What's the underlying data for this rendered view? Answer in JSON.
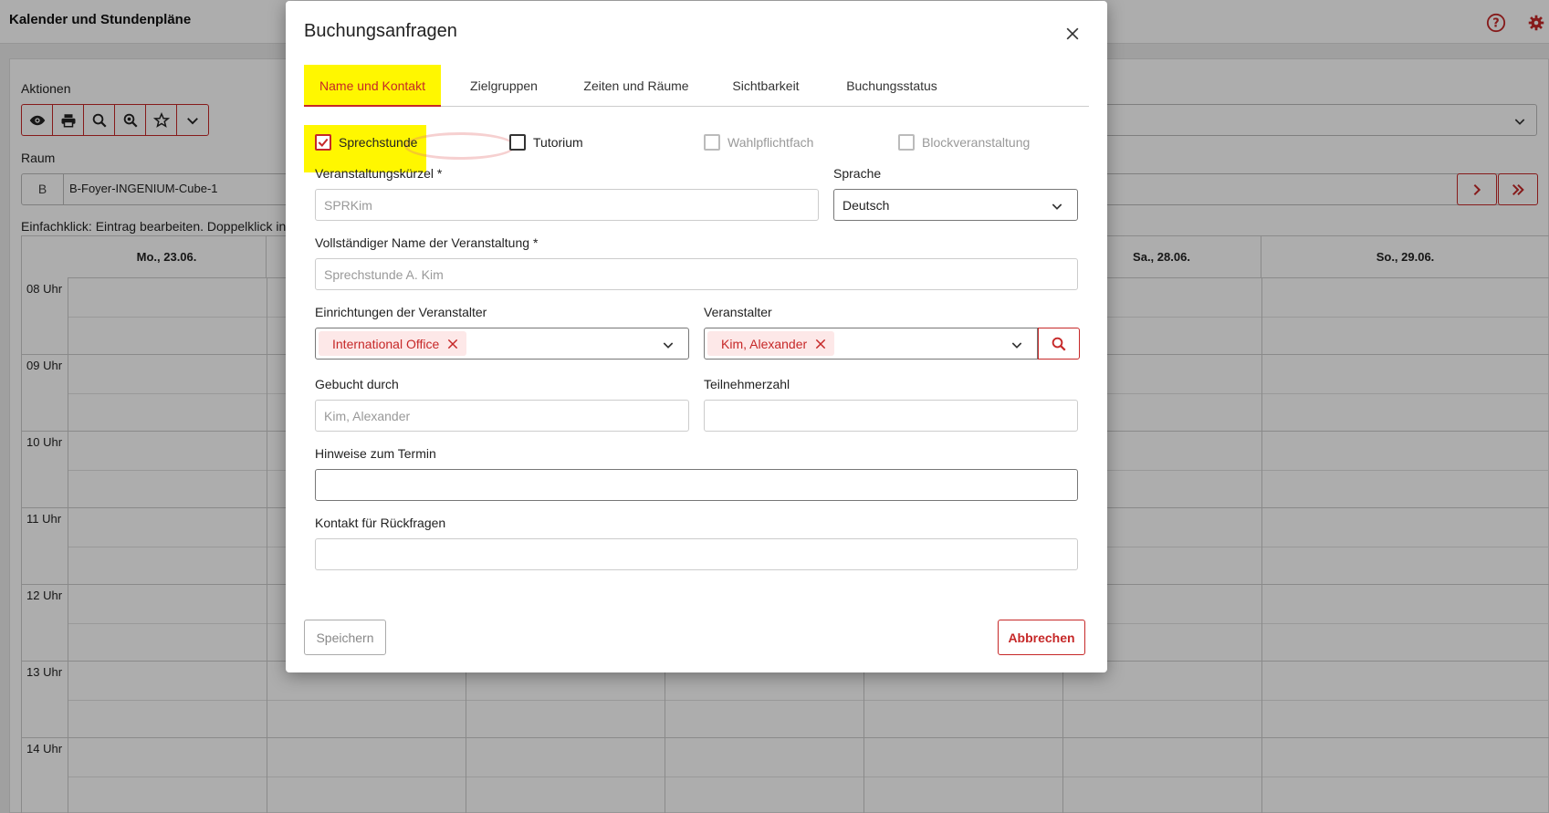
{
  "app": {
    "title": "Kalender und Stundenpläne",
    "accent_color": "#c62828",
    "highlight_color": "#fff700"
  },
  "background": {
    "actions_label": "Aktionen",
    "toolbar_icons": [
      "eye-icon",
      "print-icon",
      "search-icon",
      "zoom-icon",
      "star-icon",
      "chevron-down-icon"
    ],
    "room_label": "Raum",
    "room_prefix": "B",
    "room_name": "B-Foyer-INGENIUM-Cube-1",
    "hint": "Einfachklick: Eintrag bearbeiten. Doppelklick in",
    "days": [
      "Mo., 23.06.",
      "",
      "",
      "",
      "",
      "Sa., 28.06.",
      "So., 29.06."
    ],
    "hours": [
      "08 Uhr",
      "09 Uhr",
      "10 Uhr",
      "11 Uhr",
      "12 Uhr",
      "13 Uhr",
      "14 Uhr"
    ]
  },
  "modal": {
    "title": "Buchungsanfragen",
    "tabs": [
      "Name und Kontakt",
      "Zielgruppen",
      "Zeiten und Räume",
      "Sichtbarkeit",
      "Buchungsstatus"
    ],
    "active_tab": "Name und Kontakt",
    "checkboxes": [
      {
        "label": "Sprechstunde",
        "checked": true,
        "disabled": false
      },
      {
        "label": "Tutorium",
        "checked": false,
        "disabled": false
      },
      {
        "label": "Wahlpflichtfach",
        "checked": false,
        "disabled": true
      },
      {
        "label": "Blockveranstaltung",
        "checked": false,
        "disabled": true
      }
    ],
    "fields": {
      "kuerzel_label": "Veranstaltungskürzel",
      "kuerzel_placeholder": "SPRKim",
      "sprache_label": "Sprache",
      "sprache_value": "Deutsch",
      "name_label": "Vollständiger Name der Veranstaltung",
      "name_placeholder": "Sprechstunde  A. Kim",
      "einrichtungen_label": "Einrichtungen der Veranstalter",
      "einrichtungen_chip": "International Office",
      "veranstalter_label": "Veranstalter",
      "veranstalter_chip": "Kim, Alexander",
      "gebucht_label": "Gebucht durch",
      "gebucht_placeholder": "Kim, Alexander",
      "teilnehmer_label": "Teilnehmerzahl",
      "teilnehmer_value": "",
      "hinweise_label": "Hinweise zum Termin",
      "hinweise_value": "",
      "kontakt_label": "Kontakt für Rückfragen",
      "kontakt_value": "",
      "required_marker": "*"
    },
    "buttons": {
      "save": "Speichern",
      "cancel": "Abbrechen"
    }
  }
}
